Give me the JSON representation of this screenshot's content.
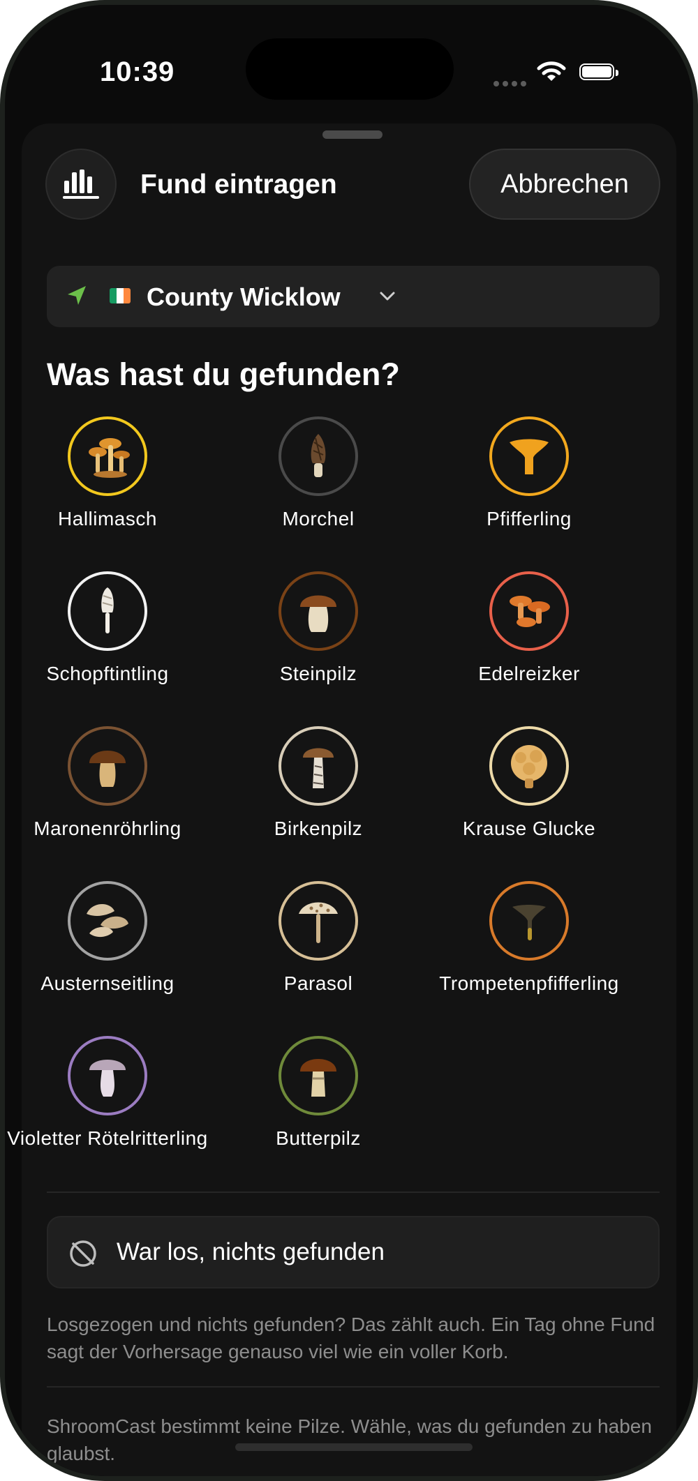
{
  "status_bar": {
    "time": "10:39"
  },
  "header": {
    "title": "Fund eintragen",
    "cancel_label": "Abbrechen",
    "stats_icon": "bar-chart-icon"
  },
  "location": {
    "flag": "Ireland",
    "name": "County Wicklow",
    "icon": "location-arrow-icon",
    "accent": "#6cc04a"
  },
  "question": "Was hast du gefunden?",
  "species": [
    {
      "name": "Hallimasch",
      "ring": "#f2c81e"
    },
    {
      "name": "Morchel",
      "ring": "#4a4a4a"
    },
    {
      "name": "Pfifferling",
      "ring": "#f2a81e"
    },
    {
      "name": "Schopftintling",
      "ring": "#f2f2f2"
    },
    {
      "name": "Steinpilz",
      "ring": "#7a4216"
    },
    {
      "name": "Edelreizker",
      "ring": "#e8604a"
    },
    {
      "name": "Maronenröhrling",
      "ring": "#7a5232"
    },
    {
      "name": "Birkenpilz",
      "ring": "#d8cdb8"
    },
    {
      "name": "Krause Glucke",
      "ring": "#ecd9a8"
    },
    {
      "name": "Austernseitling",
      "ring": "#a3a3a3"
    },
    {
      "name": "Parasol",
      "ring": "#d6bf96"
    },
    {
      "name": "Trompetenpfifferling",
      "ring": "#d87a2a"
    },
    {
      "name": "Violetter Rötelritterling",
      "ring": "#9b7cc1"
    },
    {
      "name": "Butterpilz",
      "ring": "#6f8a3a"
    }
  ],
  "nothing_found": {
    "label": "War los, nichts gefunden",
    "icon": "slash-circle-icon"
  },
  "note_nothing": "Losgezogen und nichts gefunden? Das zählt auch. Ein Tag ohne Fund sagt der Vorhersage genauso viel wie ein voller Korb.",
  "note_disclaimer": "ShroomCast bestimmt keine Pilze. Wähle, was du gefunden zu haben glaubst."
}
